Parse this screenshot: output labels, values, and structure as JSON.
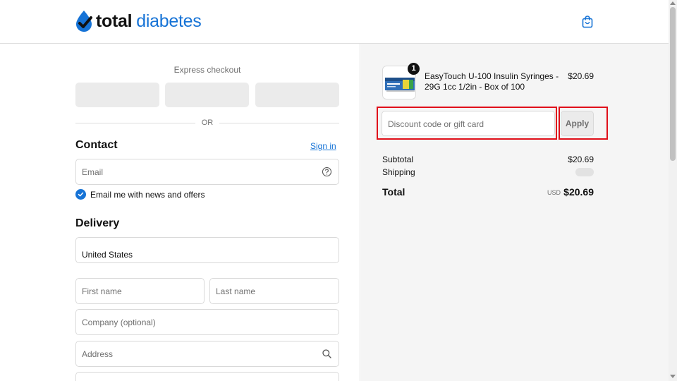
{
  "header": {
    "logo_bold": "total",
    "logo_light": "diabetes",
    "cart_icon": "shopping-bag-icon"
  },
  "express": {
    "title": "Express checkout",
    "or_label": "OR"
  },
  "contact": {
    "title": "Contact",
    "sign_in": "Sign in",
    "email_placeholder": "Email",
    "email_help_icon": "help-circle-icon",
    "news_checkbox_label": "Email me with news and offers",
    "news_checked": true
  },
  "delivery": {
    "title": "Delivery",
    "country_value": "United States",
    "first_name_placeholder": "First name",
    "last_name_placeholder": "Last name",
    "company_placeholder": "Company (optional)",
    "address_placeholder": "Address",
    "address_icon": "search-icon"
  },
  "summary": {
    "product": {
      "name": "EasyTouch U-100 Insulin Syringes - 29G 1cc 1/2in - Box of 100",
      "price": "$20.69",
      "quantity": "1"
    },
    "discount_placeholder": "Discount code or gift card",
    "apply_label": "Apply",
    "subtotal_label": "Subtotal",
    "subtotal_value": "$20.69",
    "shipping_label": "Shipping",
    "total_label": "Total",
    "total_currency": "USD",
    "total_value": "$20.69"
  },
  "colors": {
    "accent": "#1673d6",
    "highlight": "#e0101a",
    "summary_bg": "#f5f5f5"
  }
}
